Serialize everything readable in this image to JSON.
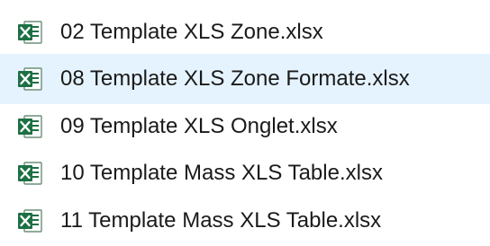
{
  "files": [
    {
      "name": "02 Template XLS Zone.xlsx",
      "icon": "excel-file-icon"
    },
    {
      "name": "08 Template XLS Zone Formate.xlsx",
      "icon": "excel-file-icon"
    },
    {
      "name": "09 Template XLS Onglet.xlsx",
      "icon": "excel-file-icon"
    },
    {
      "name": "10 Template Mass XLS Table.xlsx",
      "icon": "excel-file-icon"
    },
    {
      "name": "11 Template Mass XLS Table.xlsx",
      "icon": "excel-file-icon"
    }
  ],
  "colors": {
    "row_highlight": "#e5f3ff",
    "excel_green": "#1d7044",
    "text": "#1a1a1a"
  }
}
